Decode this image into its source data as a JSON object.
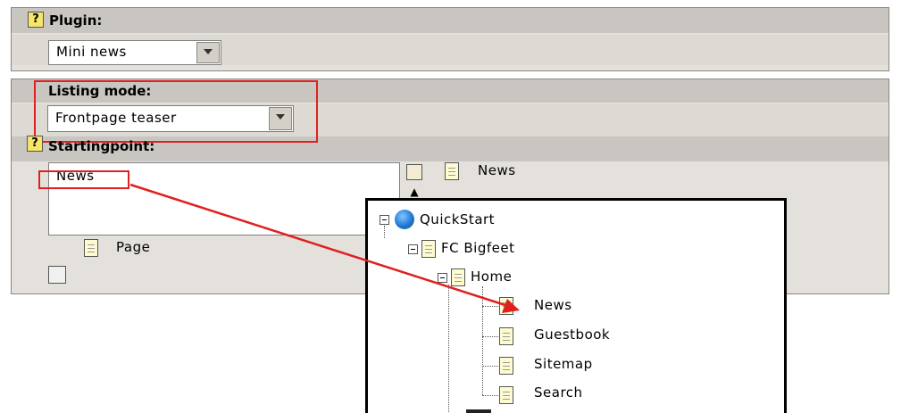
{
  "plugin": {
    "label": "Plugin:",
    "value": "Mini news"
  },
  "listing_mode": {
    "label": "Listing mode:",
    "value": "Frontpage teaser"
  },
  "startingpoint": {
    "label": "Startingpoint:",
    "selected_item": "News",
    "side_label": "News",
    "page_label": "Page"
  },
  "tree": {
    "root": "QuickStart",
    "site": "FC Bigfeet",
    "home": "Home",
    "children": [
      "News",
      "Guestbook",
      "Sitemap",
      "Search"
    ]
  },
  "colors": {
    "highlight": "#e02020"
  }
}
